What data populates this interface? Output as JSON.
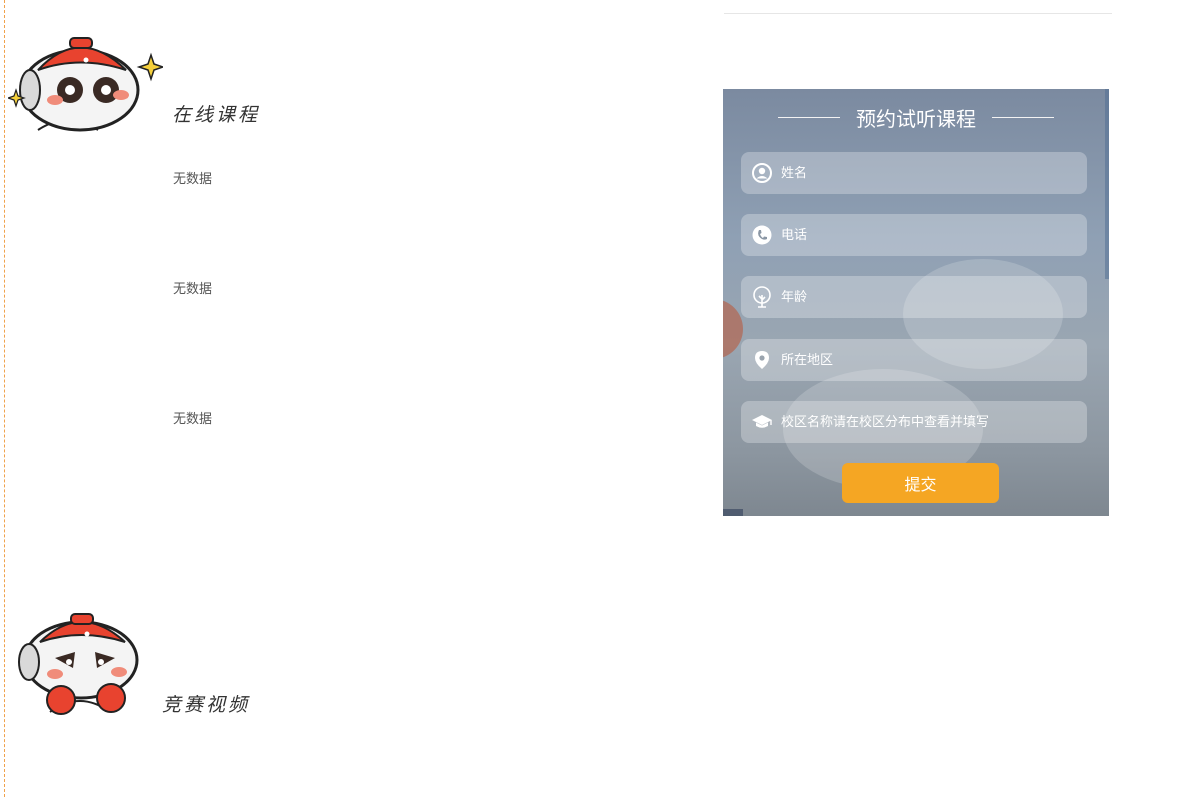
{
  "sections": {
    "online_courses": {
      "title": "在线课程",
      "items": [
        "无数据",
        "无数据",
        "无数据"
      ]
    },
    "competition_videos": {
      "title": "竞赛视频"
    }
  },
  "booking_form": {
    "title": "预约试听课程",
    "fields": {
      "name": {
        "placeholder": "姓名",
        "icon": "user-icon"
      },
      "phone": {
        "placeholder": "电话",
        "icon": "phone-icon"
      },
      "age": {
        "placeholder": "年龄",
        "icon": "tree-icon"
      },
      "region": {
        "placeholder": "所在地区",
        "icon": "location-pin-icon"
      },
      "campus": {
        "placeholder": "校区名称请在校区分布中查看并填写",
        "icon": "graduation-cap-icon"
      }
    },
    "submit_label": "提交"
  },
  "colors": {
    "accent": "#f5a623",
    "timeline": "#f0a14a",
    "mascot_red": "#e8432f"
  }
}
